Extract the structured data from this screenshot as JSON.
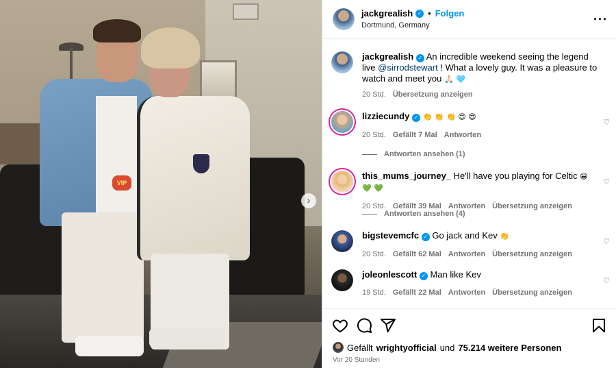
{
  "post": {
    "author": "jackgrealish",
    "follow_label": "Folgen",
    "separator": "•",
    "location": "Dortmund, Germany",
    "more_icon": "more-horizontal-icon",
    "caption": {
      "prefix": "An incredible weekend seeing the legend live",
      "mention": "@sirrodstewart",
      "suffix": "! What a lovely guy. It was a pleasure to watch and meet you",
      "emoji": "🙏🏻 🩵",
      "time": "20 Std.",
      "translate": "Übersetzung anzeigen"
    },
    "photo_badge": "VIP"
  },
  "comments": [
    {
      "user": "lizziecundy",
      "text": "",
      "emoji": "👏 👏 👏 😍 😍",
      "time": "20 Std.",
      "likes": "Gefällt 7 Mal",
      "reply": "Antworten",
      "translate": "",
      "view_replies": "Antworten ansehen (1)"
    },
    {
      "user": "this_mums_journey_",
      "text": "He'll have you playing for Celtic",
      "emoji": "😁 💚 💚",
      "time": "20 Std.",
      "likes": "Gefällt 39 Mal",
      "reply": "Antworten",
      "translate": "Übersetzung anzeigen",
      "view_replies": "Antworten ansehen (4)"
    },
    {
      "user": "bigstevemcfc",
      "text": "Go jack and Kev",
      "emoji": "👏",
      "time": "20 Std.",
      "likes": "Gefällt 62 Mal",
      "reply": "Antworten",
      "translate": "Übersetzung anzeigen"
    },
    {
      "user": "joleonlescott",
      "text": "Man like Kev",
      "emoji": "",
      "time": "19 Std.",
      "likes": "Gefällt 22 Mal",
      "reply": "Antworten",
      "translate": "Übersetzung anzeigen"
    }
  ],
  "footer": {
    "liked_prefix": "Gefällt",
    "liked_user": "wrightyofficial",
    "liked_and": "und",
    "liked_count": "75.214 weitere Personen",
    "timestamp": "Vor 20 Stunden"
  },
  "colors": {
    "accent": "#0095f6",
    "mention": "#00376b",
    "secondary_text": "#737373"
  }
}
